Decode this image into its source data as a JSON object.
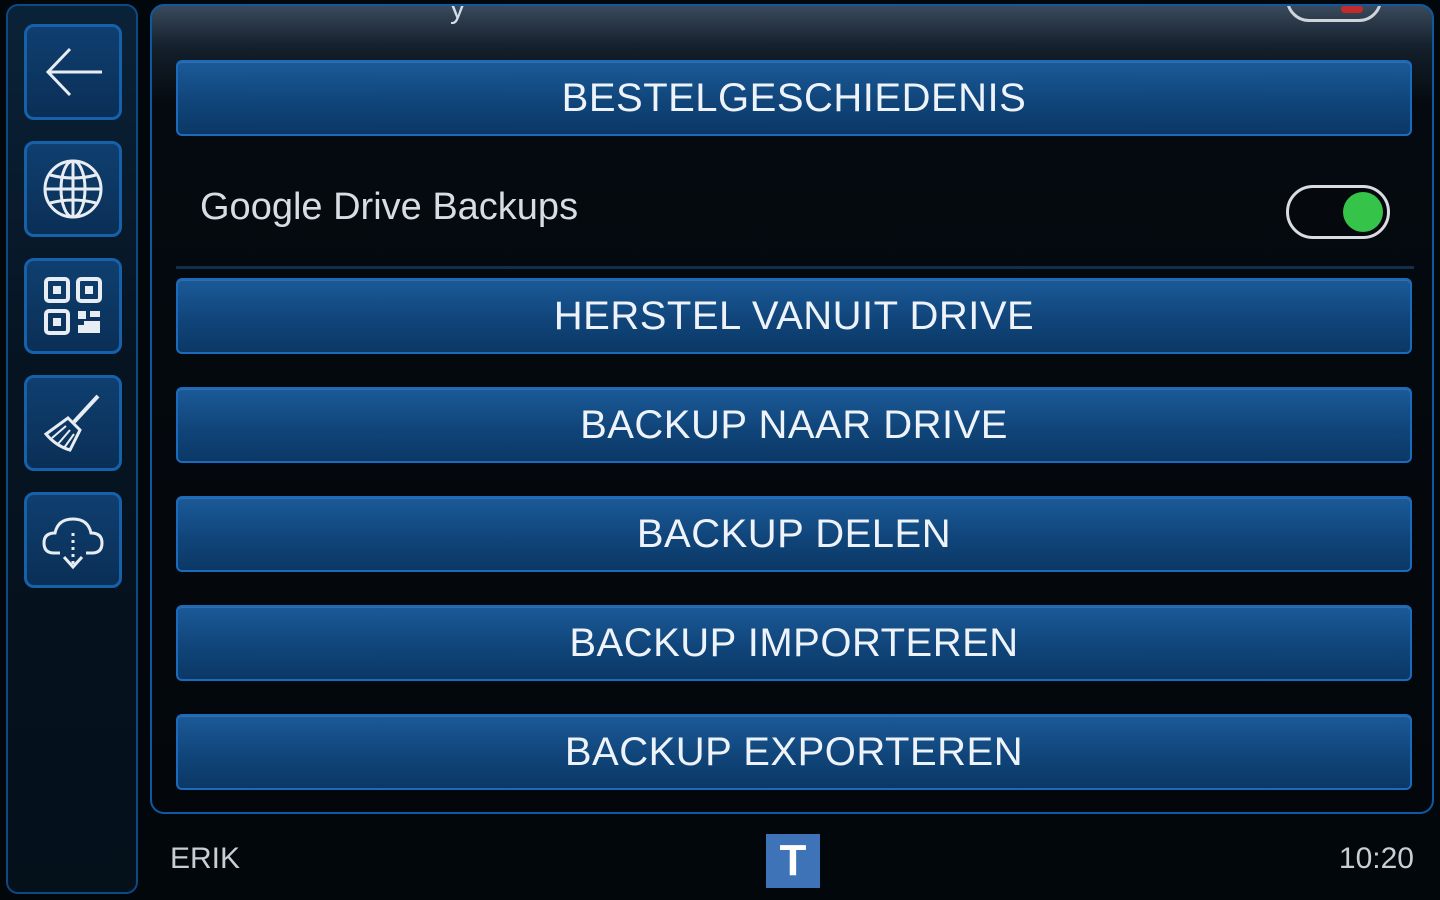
{
  "sidebar": {
    "items": [
      {
        "icon": "back-arrow-icon"
      },
      {
        "icon": "globe-icon"
      },
      {
        "icon": "qr-code-icon"
      },
      {
        "icon": "broom-icon"
      },
      {
        "icon": "cloud-download-icon"
      }
    ]
  },
  "header": {
    "partial_title": "y"
  },
  "main": {
    "order_history_label": "BESTELGESCHIEDENIS",
    "google_drive_backups": {
      "label": "Google Drive Backups",
      "enabled": true,
      "toggle_color": "#36c34a"
    },
    "restore_from_drive_label": "HERSTEL VANUIT DRIVE",
    "backup_to_drive_label": "BACKUP NAAR DRIVE",
    "share_backup_label": "BACKUP DELEN",
    "import_backup_label": "BACKUP IMPORTEREN",
    "export_backup_label": "BACKUP EXPORTEREN"
  },
  "status_bar": {
    "user": "ERIK",
    "logo_letter": "T",
    "time": "10:20"
  },
  "colors": {
    "accent": "#1a6bbd",
    "button_fill": "#10457a",
    "toggle_on": "#36c34a",
    "logo_bg": "#3e73b8"
  }
}
